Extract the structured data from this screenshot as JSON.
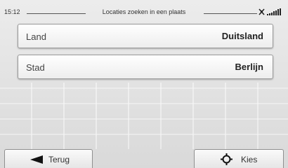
{
  "status": {
    "time": "15:12",
    "title": "Locaties zoeken in een plaats",
    "icons": [
      "gps-satellite-icon",
      "signal-strength-icon"
    ]
  },
  "fields": [
    {
      "label": "Land",
      "value": "Duitsland"
    },
    {
      "label": "Stad",
      "value": "Berlijn"
    }
  ],
  "footer": {
    "back_label": "Terug",
    "back_icon": "arrow-left-icon",
    "select_label": "Kies",
    "select_icon": "crosshair-icon"
  },
  "colors": {
    "background": "#e3e3e3",
    "row_background": "#ffffff",
    "border": "#9a9a9a",
    "text": "#333333"
  }
}
